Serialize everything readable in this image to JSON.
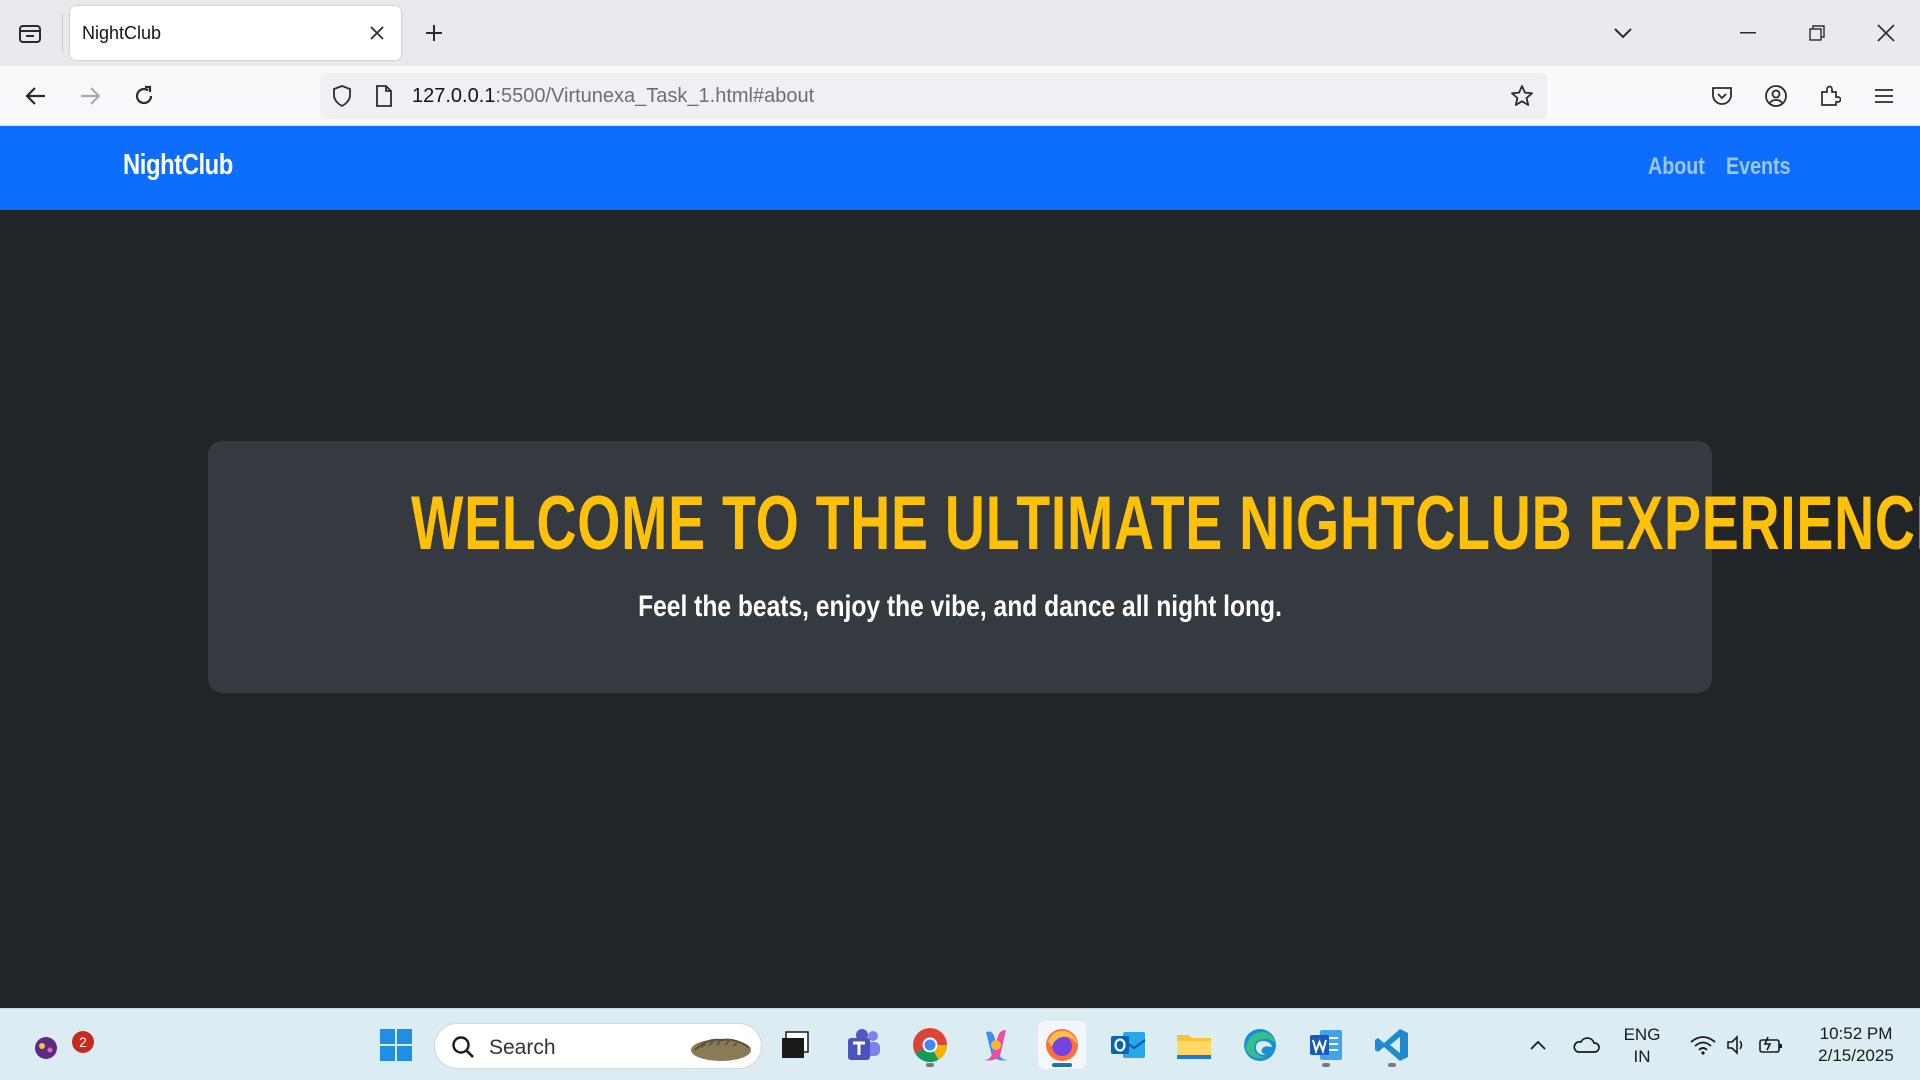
{
  "browser": {
    "tab_title": "NightClub",
    "url_host": "127.0.0.1",
    "url_rest": ":5500/Virtunexa_Task_1.html#about"
  },
  "site": {
    "brand": "NightClub",
    "nav_links": [
      "About",
      "Events"
    ],
    "hero_title": "WELCOME TO THE ULTIMATE NIGHTCLUB EXPERIENCE",
    "hero_subtitle": "Feel the beats, enjoy the vibe, and dance all night long."
  },
  "taskbar": {
    "search_placeholder": "Search",
    "notification_count": "2",
    "language_line1": "ENG",
    "language_line2": "IN",
    "time": "10:52 PM",
    "date": "2/15/2025"
  },
  "colors": {
    "navbar_bg": "#0d6efd",
    "page_bg": "#212529",
    "hero_bg": "#343a40",
    "hero_title": "#ffc107"
  }
}
